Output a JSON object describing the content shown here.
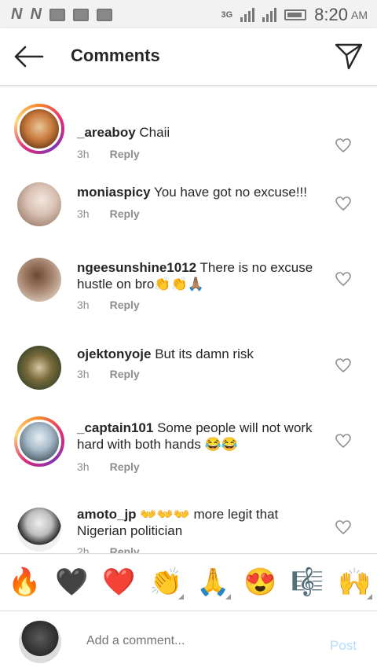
{
  "statusbar": {
    "time": "8:20",
    "ampm": "AM",
    "network": "3G"
  },
  "header": {
    "title": "Comments",
    "back_icon": "arrow-left-icon",
    "share_icon": "paper-plane-icon"
  },
  "comments": [
    {
      "username": "_areaboy",
      "text": "Chaii",
      "time": "3h",
      "reply": "Reply",
      "story_ring": true,
      "avatar_color": "#c97a3c"
    },
    {
      "username": "moniaspicy",
      "text": "You have got no excuse!!!",
      "time": "3h",
      "reply": "Reply",
      "story_ring": false,
      "avatar_color": "#e9ddd5"
    },
    {
      "username": "ngeesunshine1012",
      "text": "There is no excuse hustle on bro👏👏🙏🏽",
      "time": "3h",
      "reply": "Reply",
      "story_ring": false,
      "avatar_color": "#b08a6e"
    },
    {
      "username": "ojektonyoje",
      "text": "But its damn risk",
      "time": "3h",
      "reply": "Reply",
      "story_ring": false,
      "avatar_color": "#6b7a3a"
    },
    {
      "username": "_captain101",
      "text": "Some people will not work hard with both hands 😂😂",
      "time": "3h",
      "reply": "Reply",
      "story_ring": true,
      "avatar_color": "#8fa6b8"
    },
    {
      "username": "amoto_jp",
      "text": "👐👐👐 more legit that Nigerian politician",
      "time": "2h",
      "reply": "Reply",
      "story_ring": false,
      "avatar_color": "#9a9a9a"
    }
  ],
  "emojis": [
    {
      "char": "🔥",
      "name": "fire-emoji",
      "variants": false
    },
    {
      "char": "🖤",
      "name": "black-heart-emoji",
      "variants": false
    },
    {
      "char": "❤️",
      "name": "red-heart-emoji",
      "variants": false
    },
    {
      "char": "👏",
      "name": "clapping-hands-emoji",
      "variants": true
    },
    {
      "char": "🙏",
      "name": "folded-hands-emoji",
      "variants": true
    },
    {
      "char": "😍",
      "name": "heart-eyes-emoji",
      "variants": false
    },
    {
      "char": "🎼",
      "name": "musical-score-emoji",
      "variants": false
    },
    {
      "char": "🙌",
      "name": "raising-hands-emoji",
      "variants": true
    }
  ],
  "compose": {
    "placeholder": "Add a comment...",
    "post_label": "Post"
  }
}
